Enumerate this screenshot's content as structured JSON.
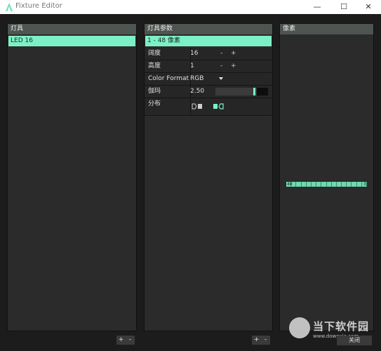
{
  "window": {
    "title": "Fixture Editor",
    "min": "—",
    "max": "☐",
    "close": "✕"
  },
  "fixtures_panel": {
    "header": "灯具",
    "items": [
      "LED 16"
    ],
    "add_label": "+",
    "remove_label": "-"
  },
  "params_panel": {
    "header": "灯具参数",
    "selected_row": "1 - 48   像素",
    "rows": {
      "width": {
        "label": "阔度",
        "value": "16",
        "minus": "-",
        "plus": "+"
      },
      "height": {
        "label": "高度",
        "value": "1",
        "minus": "-",
        "plus": "+"
      },
      "color_format": {
        "label": "Color Format",
        "value": "RGB"
      },
      "gamma": {
        "label": "伽玛",
        "value": "2.50",
        "level": 0.75
      },
      "distribution": {
        "label": "分布"
      }
    },
    "add_label": "+",
    "remove_label": "-"
  },
  "pixels_panel": {
    "header": "像素",
    "strip_start": "48",
    "strip_end": "3",
    "pixel_count": 16
  },
  "close_button": "关闭",
  "watermark": {
    "text": "当下软件园",
    "url": "www.downxia.com"
  },
  "colors": {
    "accent": "#7cf0c6",
    "header": "#4e5550",
    "panel": "#2b2b2b",
    "background": "#1c1c1c"
  }
}
